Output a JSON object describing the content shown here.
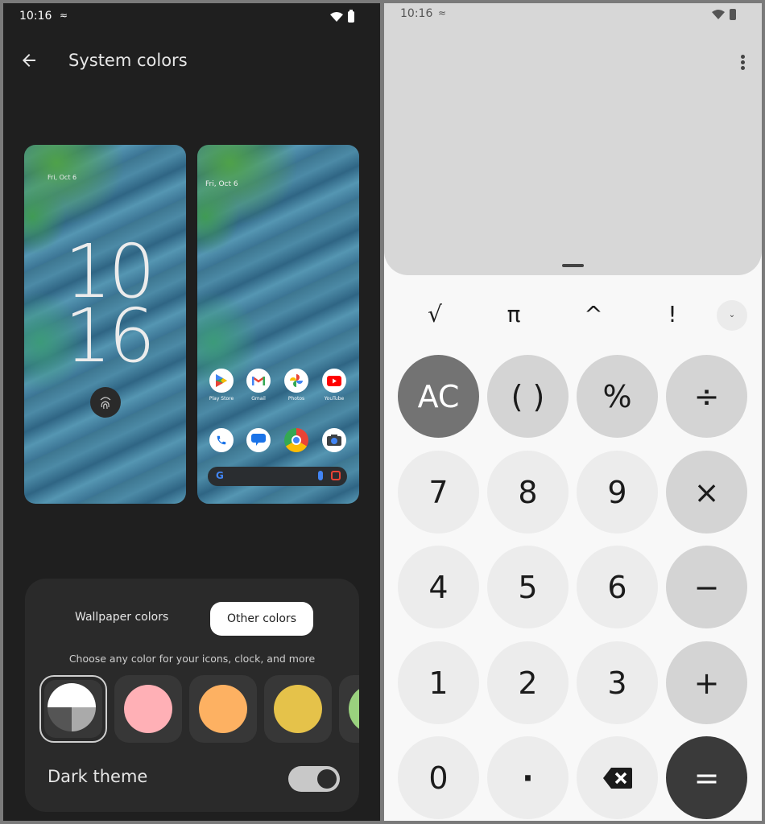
{
  "left_screen": {
    "status_bar": {
      "time": "10:16",
      "signal_icon": "signal-off-icon",
      "wifi_icon": "wifi-icon",
      "battery_icon": "battery-icon"
    },
    "app_bar": {
      "back_icon": "arrow-back-icon",
      "title": "System colors"
    },
    "lock_preview": {
      "date": "Fri, Oct 6",
      "clock_hour": "10",
      "clock_minute": "16",
      "fingerprint_icon": "fingerprint-icon"
    },
    "home_preview": {
      "date": "Fri, Oct 6",
      "apps": [
        {
          "label": "Play Store",
          "icon": "play-store-icon"
        },
        {
          "label": "Gmail",
          "icon": "gmail-icon"
        },
        {
          "label": "Photos",
          "icon": "photos-icon"
        },
        {
          "label": "YouTube",
          "icon": "youtube-icon"
        }
      ],
      "dock": [
        {
          "icon": "phone-icon"
        },
        {
          "icon": "messages-icon"
        },
        {
          "icon": "chrome-icon"
        },
        {
          "icon": "camera-icon"
        }
      ],
      "search_bar": {
        "g_logo": "G",
        "mic_icon": "mic-icon",
        "lens_icon": "lens-icon"
      }
    },
    "color_card": {
      "tabs": [
        {
          "label": "Wallpaper colors",
          "selected": false
        },
        {
          "label": "Other colors",
          "selected": true
        }
      ],
      "hint": "Choose any color for your icons, clock, and more",
      "swatches": [
        {
          "name": "monochrome",
          "selected": true,
          "colors": [
            "#ffffff",
            "#555555",
            "#aaaaaa"
          ]
        },
        {
          "name": "pink",
          "selected": false,
          "color": "#ffb0b6"
        },
        {
          "name": "orange",
          "selected": false,
          "color": "#fdb162"
        },
        {
          "name": "yellow",
          "selected": false,
          "color": "#e5c24a"
        },
        {
          "name": "green",
          "selected": false,
          "color": "#9ad27e"
        }
      ],
      "dark_theme": {
        "label": "Dark theme",
        "enabled": true
      }
    }
  },
  "right_screen": {
    "status_bar": {
      "time": "10:16",
      "signal_icon": "signal-off-icon",
      "wifi_icon": "wifi-icon",
      "battery_icon": "battery-icon"
    },
    "more_menu_icon": "more-vert-icon",
    "display_value": "",
    "scientific_row": [
      "√",
      "π",
      "^",
      "!"
    ],
    "expand_icon": "chevron-down-icon",
    "keypad": [
      [
        {
          "label": "AC",
          "type": "ac"
        },
        {
          "label": "( )",
          "type": "op"
        },
        {
          "label": "%",
          "type": "op"
        },
        {
          "label": "÷",
          "type": "op"
        }
      ],
      [
        {
          "label": "7",
          "type": "num"
        },
        {
          "label": "8",
          "type": "num"
        },
        {
          "label": "9",
          "type": "num"
        },
        {
          "label": "×",
          "type": "op"
        }
      ],
      [
        {
          "label": "4",
          "type": "num"
        },
        {
          "label": "5",
          "type": "num"
        },
        {
          "label": "6",
          "type": "num"
        },
        {
          "label": "−",
          "type": "op"
        }
      ],
      [
        {
          "label": "1",
          "type": "num"
        },
        {
          "label": "2",
          "type": "num"
        },
        {
          "label": "3",
          "type": "num"
        },
        {
          "label": "+",
          "type": "op"
        }
      ],
      [
        {
          "label": "0",
          "type": "num"
        },
        {
          "label": "·",
          "type": "num"
        },
        {
          "label": "⌫",
          "type": "num",
          "icon": "backspace-icon"
        },
        {
          "label": "=",
          "type": "eq"
        }
      ]
    ]
  }
}
